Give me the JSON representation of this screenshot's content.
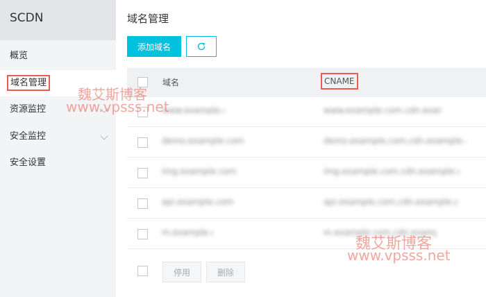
{
  "sidebar": {
    "title": "SCDN",
    "items": [
      {
        "label": "概览"
      },
      {
        "label": "域名管理"
      },
      {
        "label": "资源监控"
      },
      {
        "label": "安全监控"
      },
      {
        "label": "安全设置"
      }
    ]
  },
  "main": {
    "title": "域名管理",
    "add_button": "添加域名",
    "refresh_icon": "refresh-icon",
    "table": {
      "headers": [
        "域名",
        "CNAME"
      ],
      "rows": [
        {
          "domain": "www.example.com",
          "cname": "www.example.com.cdn.example.com"
        },
        {
          "domain": "demo.example.com",
          "cname": "demo.example.com.cdn.example.com"
        },
        {
          "domain": "img.example.com",
          "cname": "img.example.com.cdn.example.com"
        },
        {
          "domain": "api.example.com",
          "cname": "api.example.com.cdn.example.com"
        },
        {
          "domain": "m.example.com",
          "cname": "m.example.com.cdn.example.com"
        }
      ]
    },
    "footer": {
      "disable_button": "停用",
      "delete_button": "删除"
    }
  },
  "watermarks": [
    {
      "text": "魏艾斯博客"
    },
    {
      "text": "www.vpsss.net"
    }
  ],
  "colors": {
    "accent": "#00c1de",
    "highlight": "#ec5b4e"
  }
}
